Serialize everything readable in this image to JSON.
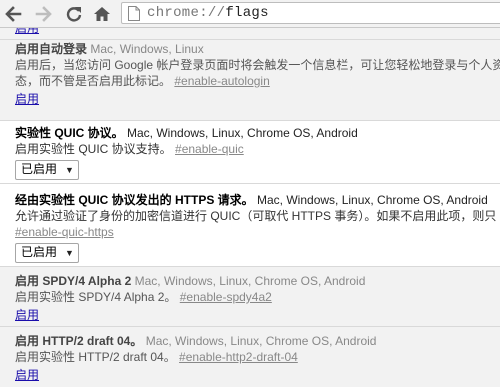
{
  "toolbar": {
    "url_scheme": "chrome://",
    "url_path": "flags",
    "back_icon": "arrow-left",
    "forward_icon": "arrow-right",
    "reload_icon": "reload",
    "home_icon": "home"
  },
  "top_link": "启用",
  "experiments": [
    {
      "name": "启用自动登录",
      "platforms": "Mac, Windows, Linux",
      "desc_line1": "启用后，当您访问 Google 帐户登录页面时将会触发一个信息栏，可让您轻松地登录与个人资",
      "desc_line2": "态，而不管是否启用此标记。",
      "permalink": "#enable-autologin",
      "action": "启用"
    },
    {
      "name": "实验性 QUIC 协议。",
      "platforms": "Mac, Windows, Linux, Chrome OS, Android",
      "desc": "启用实验性 QUIC 协议支持。",
      "permalink": "#enable-quic",
      "select_value": "已启用"
    },
    {
      "name": "经由实验性 QUIC 协议发出的 HTTPS 请求。",
      "platforms": "Mac, Windows, Linux, Chrome OS, Android",
      "desc": "允许通过验证了身份的加密信道进行 QUIC（可取代 HTTPS 事务）。如果不启用此项，则只",
      "permalink": "#enable-quic-https",
      "select_value": "已启用"
    },
    {
      "name": "启用 SPDY/4 Alpha 2",
      "platforms": "Mac, Windows, Linux, Chrome OS, Android",
      "desc": "启用实验性 SPDY/4 Alpha 2。",
      "permalink": "#enable-spdy4a2",
      "action": "启用"
    },
    {
      "name": "启用 HTTP/2 draft 04。",
      "platforms": "Mac, Windows, Linux, Chrome OS, Android",
      "desc": "启用实验性 HTTP/2 draft 04。",
      "permalink": "#enable-http2-draft-04",
      "action": "启用"
    }
  ]
}
